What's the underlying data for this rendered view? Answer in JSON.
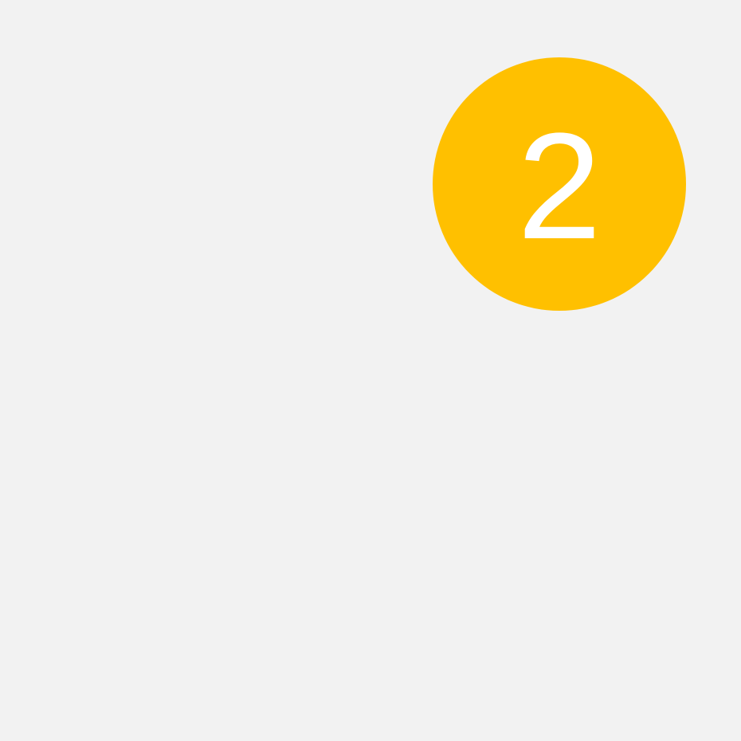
{
  "badge": {
    "count": "2",
    "background_color": "#ffc000",
    "text_color": "#ffffff"
  },
  "canvas": {
    "background_color": "#f2f2f2"
  }
}
